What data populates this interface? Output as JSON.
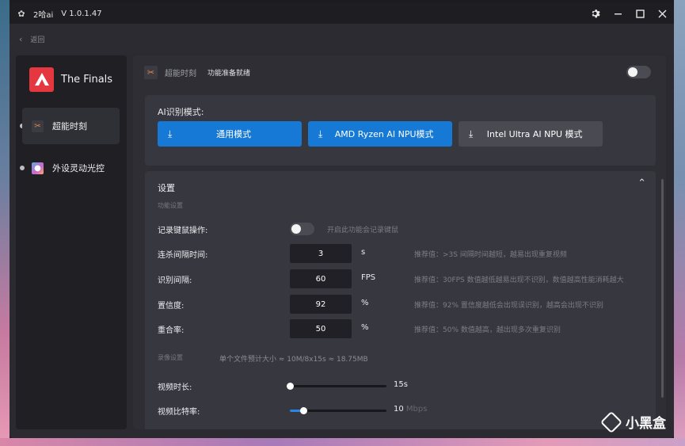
{
  "titlebar": {
    "app_name": "2哈ai",
    "version": "V 1.0.1.47",
    "icons": [
      "gear-icon",
      "minimize-icon",
      "maximize-icon",
      "close-icon"
    ]
  },
  "backbar": {
    "back_label": "返回"
  },
  "sidebar": {
    "brand": "The Finals",
    "items": [
      {
        "label": "超能时刻",
        "icon": "highlight-clip-icon",
        "active": true
      },
      {
        "label": "外设灵动光控",
        "icon": "rgb-light-icon",
        "active": false
      }
    ]
  },
  "main": {
    "title": "超能时刻",
    "status": "功能准备就绪",
    "enabled": false,
    "mode": {
      "label": "AI识别模式:",
      "buttons": [
        {
          "label": "通用模式",
          "selected": true
        },
        {
          "label": "AMD Ryzen AI NPU模式",
          "selected": true
        },
        {
          "label": "Intel Ultra AI NPU 模式",
          "selected": false
        }
      ]
    },
    "settings": {
      "title": "设置",
      "subtitle": "功能设置",
      "record_keys": {
        "label": "记录键鼠操作:",
        "enabled": false,
        "hint": "开启此功能会记录键鼠"
      },
      "rows": [
        {
          "label": "连杀间隔时间:",
          "value": "3",
          "unit": "s",
          "hint": "推荐值：>3S 间隔时间越短，越易出现重复视频"
        },
        {
          "label": "识别间隔:",
          "value": "60",
          "unit": "FPS",
          "hint": "推荐值：30FPS 数值越低越易出现不识别，数值越高性能消耗越大"
        },
        {
          "label": "置信度:",
          "value": "92",
          "unit": "%",
          "hint": "推荐值：92% 置信度越低会出现误识别，越高会出现不识别"
        },
        {
          "label": "重合率:",
          "value": "50",
          "unit": "%",
          "hint": "推荐值：50% 数值越高，越出现多次重复识别"
        }
      ],
      "recording": {
        "label": "录像设置",
        "info": "单个文件预计大小 ≈ 10M/8x15s ≈ 18.75MB"
      },
      "sliders": [
        {
          "label": "视频时长:",
          "value": "15s",
          "unit": "",
          "level": 0
        },
        {
          "label": "视频比特率:",
          "value": "10",
          "unit": "Mbps",
          "level": 0.14
        }
      ]
    }
  },
  "watermark": "小黑盒",
  "colors": {
    "accent": "#1779d6",
    "brand": "#e5373f"
  }
}
